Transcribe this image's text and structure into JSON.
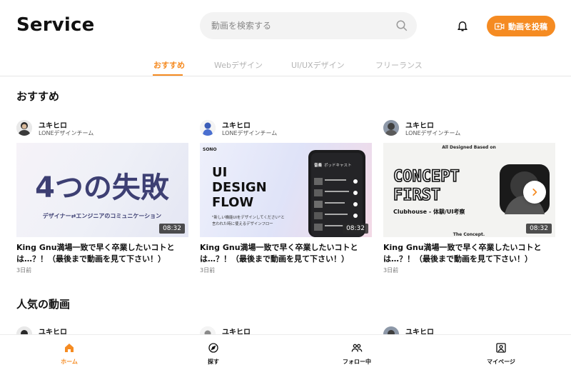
{
  "header": {
    "logo": "Service",
    "search_placeholder": "動画を検索する",
    "post_button": "動画を投稿"
  },
  "tabs": [
    {
      "label": "おすすめ",
      "active": true
    },
    {
      "label": "Webデザイン",
      "active": false
    },
    {
      "label": "UI/UXデザイン",
      "active": false
    },
    {
      "label": "フリーランス",
      "active": false
    }
  ],
  "sections": {
    "recommended": "おすすめ",
    "popular": "人気の動画"
  },
  "cards": [
    {
      "author": "ユキヒロ",
      "team": "LONEデザインチーム",
      "thumb_title": "4つの失敗",
      "thumb_sub": "デザイナー⇄エンジニアのコミュニケーション",
      "duration": "08:32",
      "title": "King Gnu満場一致で早く卒業したいコトとは…？！（最後まで動画を見て下さい！）",
      "date": "3日前"
    },
    {
      "author": "ユキヒロ",
      "team": "LONEデザインチーム",
      "thumb_brand": "SONO",
      "thumb_line1": "UI",
      "thumb_line2": "DESIGN",
      "thumb_line3": "FLOW",
      "thumb_sub1": "\"新しい機能UIをデザインしてください\"と",
      "thumb_sub2": "言われた時に使えるデザインフロー",
      "phone_tab1": "音楽",
      "phone_tab2": "ポッドキャスト",
      "duration": "08:32",
      "title": "King Gnu満場一致で早く卒業したいコトとは…？！（最後まで動画を見て下さい！）",
      "date": "3日前"
    },
    {
      "author": "ユキヒロ",
      "team": "LONEデザインチーム",
      "thumb_top": "All Designed Based on",
      "thumb_line1": "CONCEPT",
      "thumb_line2": "FIRST",
      "thumb_sub": "Clubhouse - 体験/UI考察",
      "thumb_bottom": "The Concept.",
      "duration": "08:32",
      "title": "King Gnu満場一致で早く卒業したいコトとは…？！（最後まで動画を見て下さい！）",
      "date": "3日前"
    }
  ],
  "popular_cards": [
    {
      "author": "ユキヒロ"
    },
    {
      "author": "ユキヒロ"
    },
    {
      "author": "ユキヒロ"
    }
  ],
  "bottom_nav": [
    {
      "label": "ホーム",
      "icon": "home-icon",
      "active": true
    },
    {
      "label": "探す",
      "icon": "compass-icon",
      "active": false
    },
    {
      "label": "フォロー中",
      "icon": "users-icon",
      "active": false
    },
    {
      "label": "マイページ",
      "icon": "user-square-icon",
      "active": false
    }
  ],
  "colors": {
    "accent": "#f58b22"
  }
}
